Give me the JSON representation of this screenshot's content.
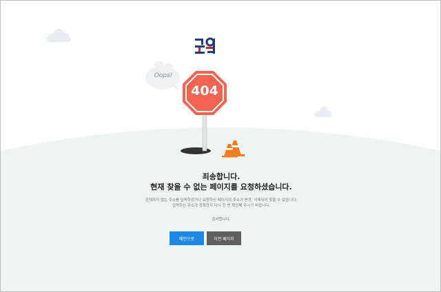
{
  "logo": {
    "text": "국회"
  },
  "sign": {
    "code": "404",
    "bubble": "Oops!"
  },
  "message": {
    "title_line1": "죄송합니다.",
    "title_line2": "현재 찾을 수 없는 페이지를 요청하셨습니다.",
    "desc_line1": "존재하지 않는 주소를 입력하셨거나 요청하신 페이지의 주소가 변경, 삭제되어 찾을 수 없습니다.",
    "desc_line2": "입력하신 주소가 정확한지 다시 한 번 확인해 주시기 바랍니다.",
    "thanks": "감사합니다."
  },
  "buttons": {
    "main_label": "메인으로",
    "prev_label": "이전 페이지"
  },
  "colors": {
    "sign_red": "#f26451",
    "hill": "#eef4f3",
    "primary_button": "#1e88e5",
    "secondary_button": "#5f5f5f",
    "cone_orange": "#f47c20"
  },
  "icons": [
    "cloud-icon",
    "speech-bubble-icon",
    "stop-sign-icon",
    "traffic-cone-icon",
    "hole-icon",
    "national-assembly-logo"
  ]
}
